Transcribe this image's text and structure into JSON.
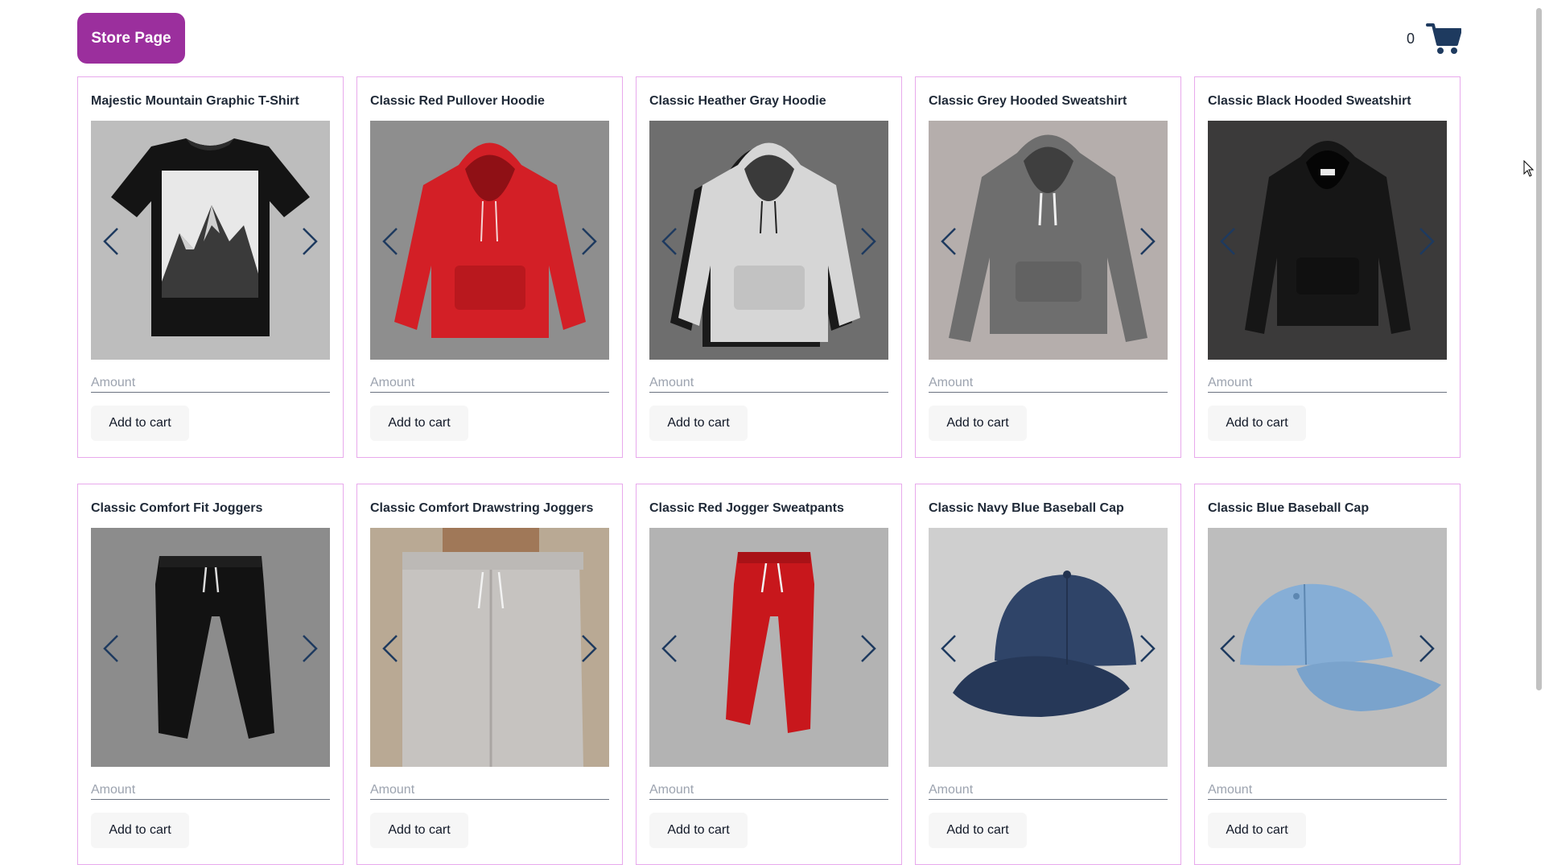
{
  "header": {
    "store_button_label": "Store Page",
    "cart_count": "0",
    "cart_icon": "shopping-cart-icon"
  },
  "colors": {
    "brand": "#9b2f9d",
    "card_border": "#e8a9ec",
    "arrow": "#1e3a5f"
  },
  "products": [
    {
      "title": "Majestic Mountain Graphic T-Shirt",
      "image": "black-tshirt-mountain",
      "amount_placeholder": "Amount",
      "add_label": "Add to cart"
    },
    {
      "title": "Classic Red Pullover Hoodie",
      "image": "red-hoodie",
      "amount_placeholder": "Amount",
      "add_label": "Add to cart"
    },
    {
      "title": "Classic Heather Gray Hoodie",
      "image": "light-gray-hoodie",
      "amount_placeholder": "Amount",
      "add_label": "Add to cart"
    },
    {
      "title": "Classic Grey Hooded Sweatshirt",
      "image": "grey-hoodie",
      "amount_placeholder": "Amount",
      "add_label": "Add to cart"
    },
    {
      "title": "Classic Black Hooded Sweatshirt",
      "image": "black-hoodie",
      "amount_placeholder": "Amount",
      "add_label": "Add to cart"
    },
    {
      "title": "Classic Comfort Fit Joggers",
      "image": "black-joggers",
      "amount_placeholder": "Amount",
      "add_label": "Add to cart"
    },
    {
      "title": "Classic Comfort Drawstring Joggers",
      "image": "gray-drawstring-joggers",
      "amount_placeholder": "Amount",
      "add_label": "Add to cart"
    },
    {
      "title": "Classic Red Jogger Sweatpants",
      "image": "red-joggers",
      "amount_placeholder": "Amount",
      "add_label": "Add to cart"
    },
    {
      "title": "Classic Navy Blue Baseball Cap",
      "image": "navy-cap",
      "amount_placeholder": "Amount",
      "add_label": "Add to cart"
    },
    {
      "title": "Classic Blue Baseball Cap",
      "image": "light-blue-cap",
      "amount_placeholder": "Amount",
      "add_label": "Add to cart"
    }
  ]
}
